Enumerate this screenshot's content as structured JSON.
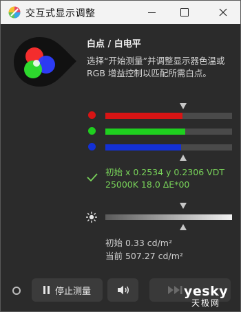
{
  "window": {
    "title": "交互式显示调整"
  },
  "panel": {
    "heading": "白点 / 白电平",
    "description": "选择“开始测量”并调整显示器色温或RGB 增益控制以匹配所需白点。"
  },
  "rgb_sliders": [
    {
      "channel": "red",
      "color": "#d81414",
      "level": 0.61
    },
    {
      "channel": "green",
      "color": "#1fcf1f",
      "level": 0.63
    },
    {
      "channel": "blue",
      "color": "#1330d6",
      "level": 0.6
    }
  ],
  "status": {
    "line1": "初始 x 0.2534 y 0.2306 VDT",
    "line2": "25000K 18.0 ΔE*00",
    "color": "#79d45a"
  },
  "luminance": {
    "level": 1.0,
    "initial": "初始 0.33 cd/m²",
    "current": "当前 507.27 cd/m²"
  },
  "toolbar": {
    "stop_label": "停止测量",
    "stop_icon": "pause-icon",
    "sound_icon": "speaker-icon",
    "next_icon": "skip-next-icon"
  },
  "watermark": {
    "main": "yesky",
    "sub": "天极网"
  }
}
